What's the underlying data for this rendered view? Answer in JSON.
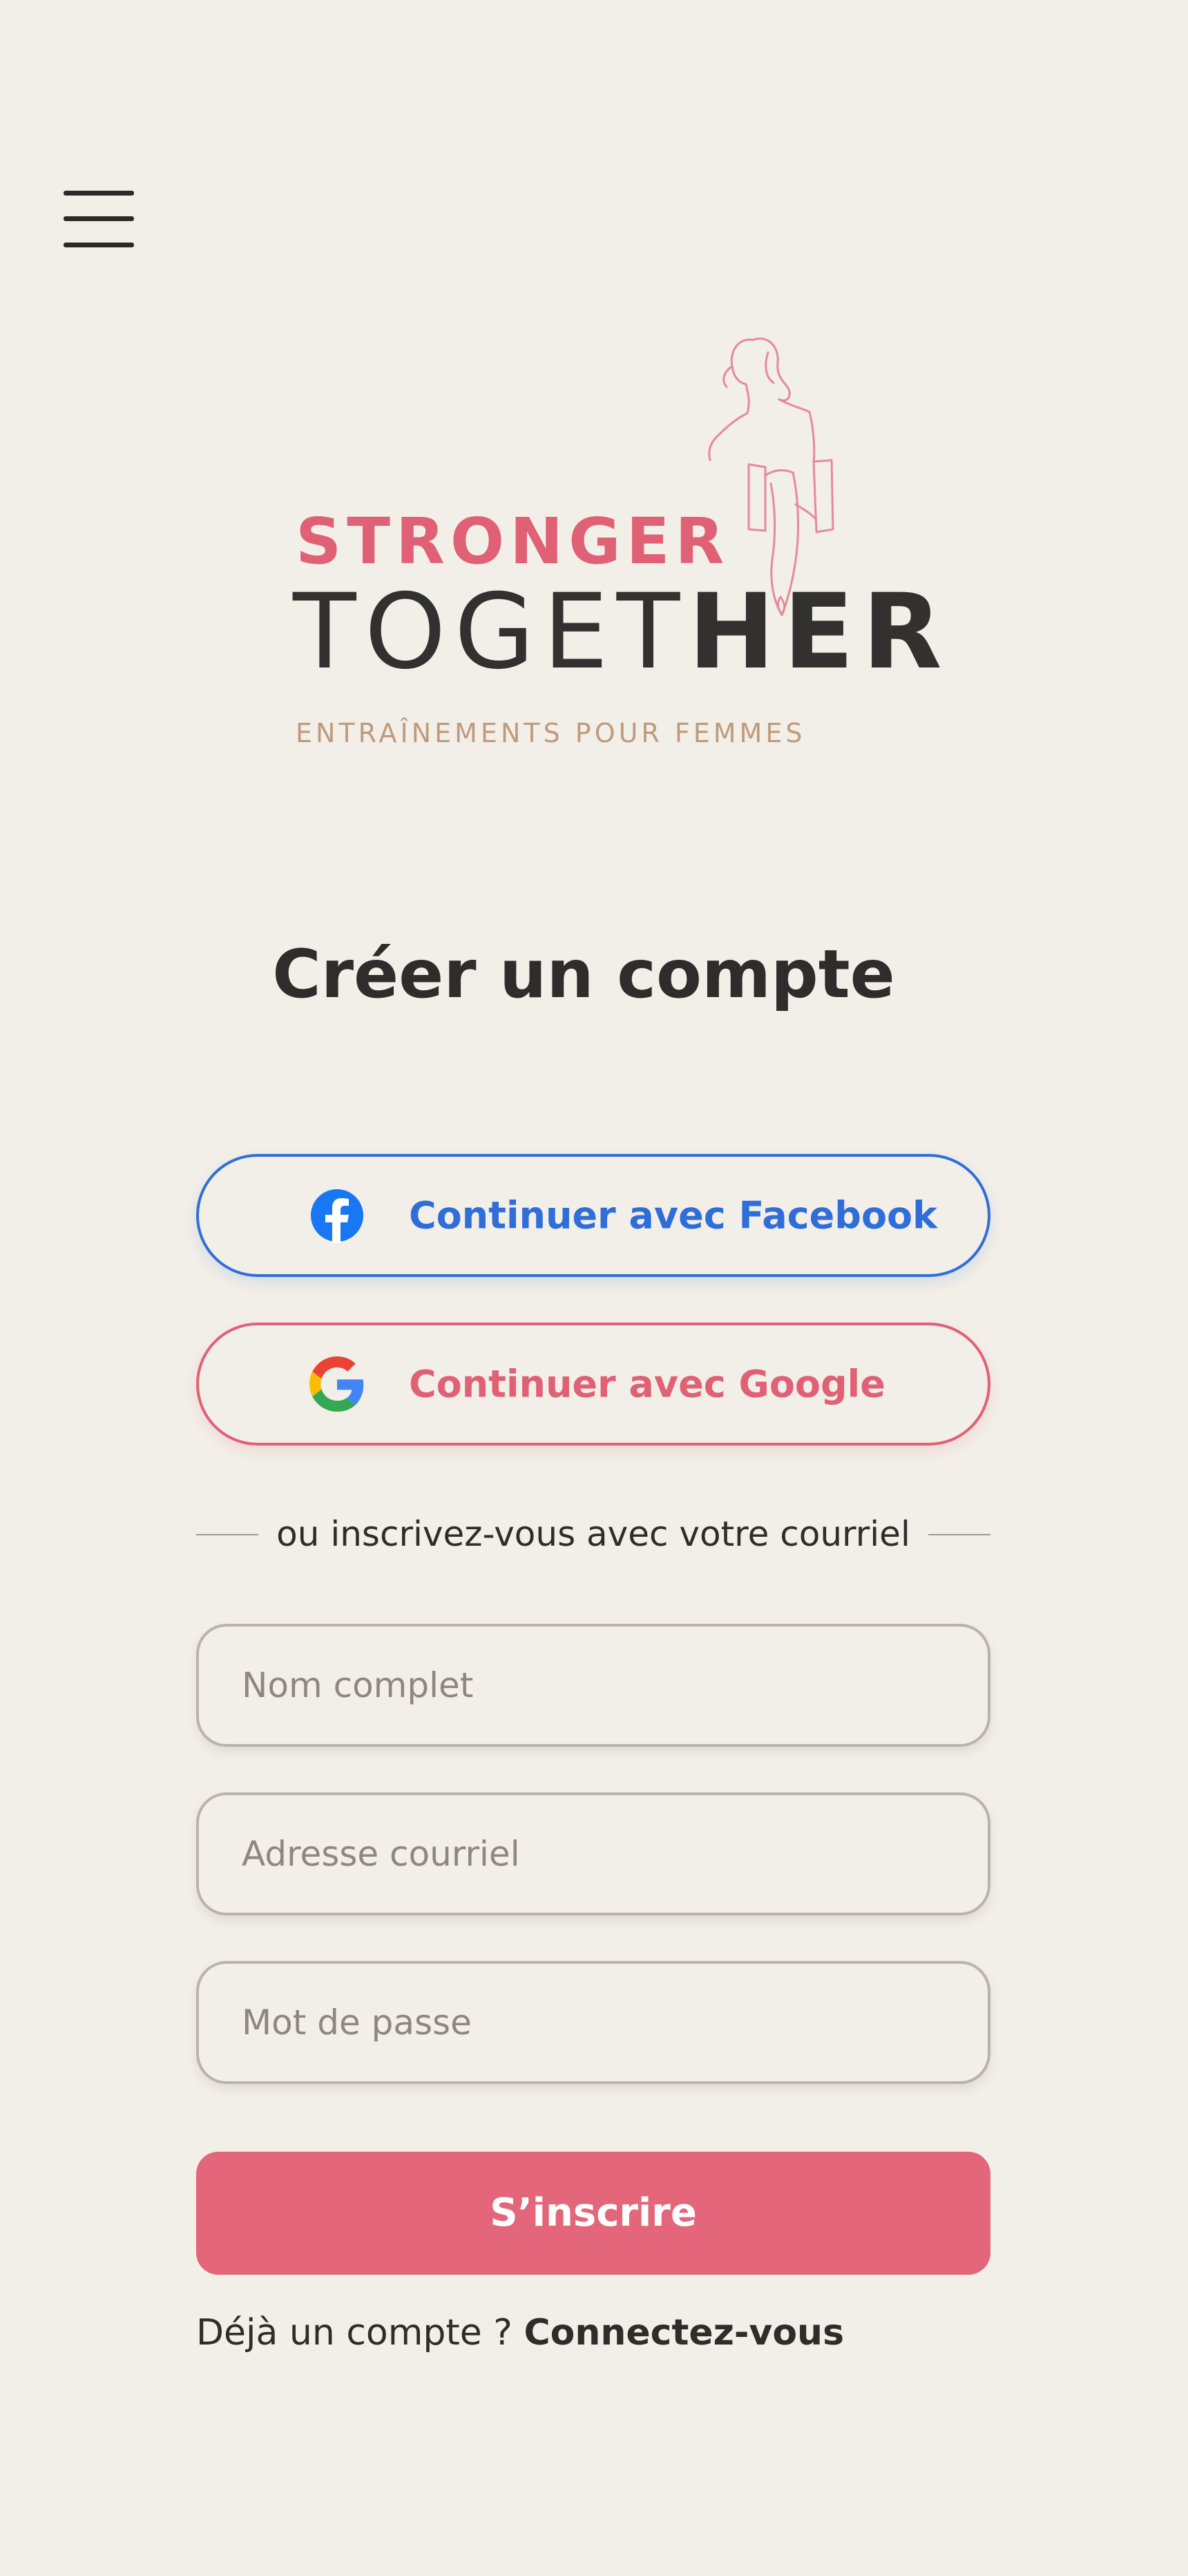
{
  "header": {
    "menu_icon": "hamburger-menu-icon"
  },
  "logo": {
    "line1": "STRONGER",
    "line2_thin": "TOGET",
    "line2_bold": "HER",
    "tagline": "ENTRAÎNEMENTS POUR FEMMES",
    "illustration": "woman-line-art",
    "colors": {
      "accent": "#e06075",
      "dark": "#333130",
      "tagline": "#c09a7c"
    }
  },
  "page": {
    "title": "Créer un compte"
  },
  "social": {
    "facebook_label": "Continuer avec Facebook",
    "facebook_icon": "facebook-icon",
    "facebook_color": "#2f6ed8",
    "google_label": "Continuer avec Google",
    "google_icon": "google-icon",
    "google_color": "#e06075"
  },
  "divider": {
    "text": "ou inscrivez-vous avec votre courriel"
  },
  "form": {
    "name_placeholder": "Nom complet",
    "name_value": "",
    "email_placeholder": "Adresse courriel",
    "email_value": "",
    "password_placeholder": "Mot de passe",
    "password_value": "",
    "submit_label": "S’inscrire",
    "submit_color": "#e3667a"
  },
  "footer": {
    "prompt": "Déjà un compte ? ",
    "link": "Connectez-vous"
  }
}
